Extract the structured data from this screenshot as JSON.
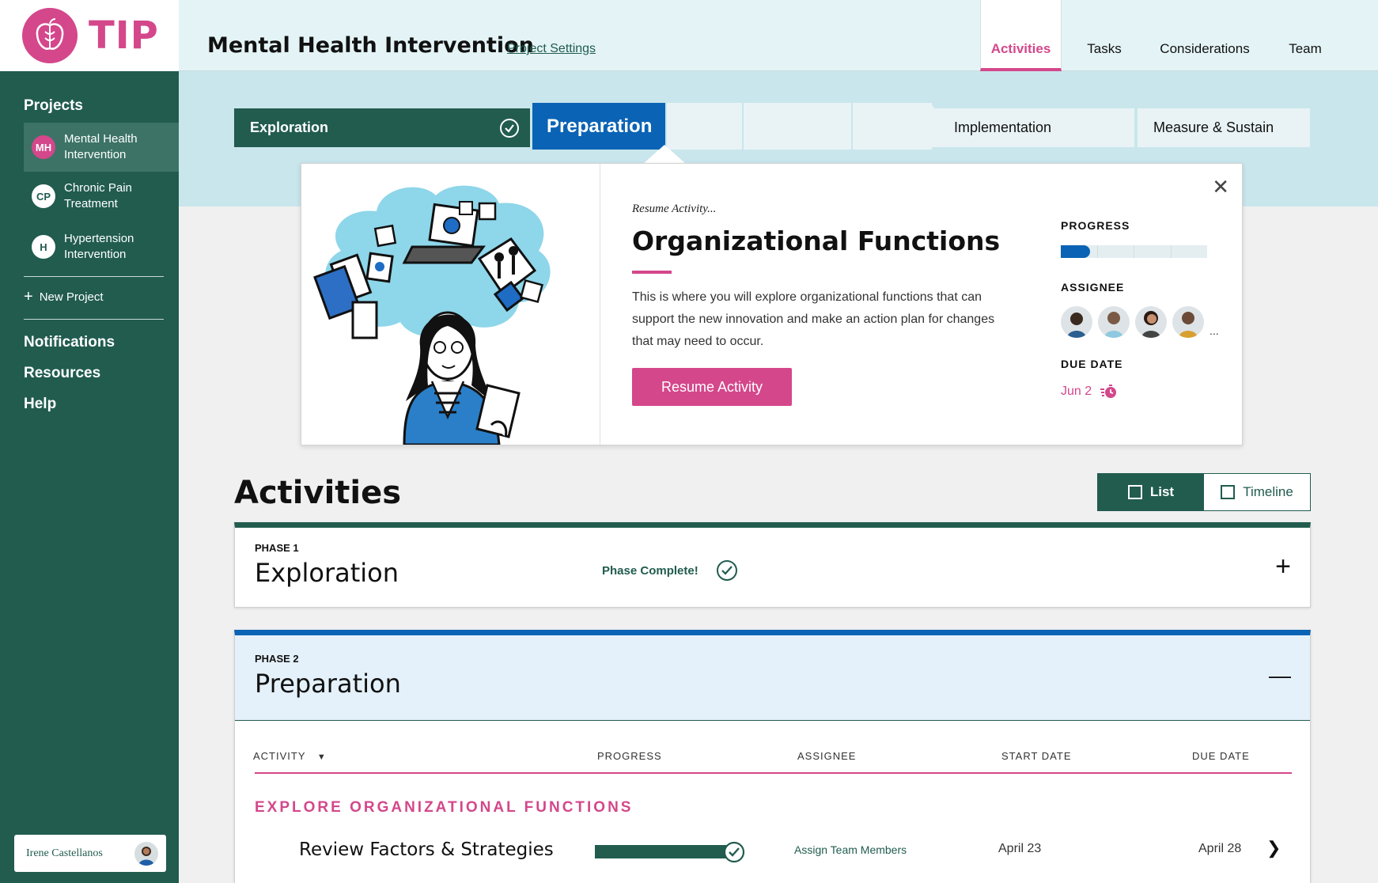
{
  "brand": {
    "logo_text": "TIP",
    "accent": "#d4478b",
    "primary": "#215c4f",
    "blue": "#0a63b5"
  },
  "sidebar": {
    "projects_heading": "Projects",
    "projects": [
      {
        "badge": "MH",
        "label": "Mental Health Intervention",
        "active": true
      },
      {
        "badge": "CP",
        "label": "Chronic Pain Treatment",
        "active": false
      },
      {
        "badge": "H",
        "label": "Hypertension Intervention",
        "active": false
      }
    ],
    "new_project": "New Project",
    "links": [
      "Notifications",
      "Resources",
      "Help"
    ],
    "user_name": "Irene Castellanos"
  },
  "header": {
    "title": "Mental Health Intervention",
    "settings_link": "Project Settings",
    "tabs": [
      "Activities",
      "Tasks",
      "Considerations",
      "Team"
    ],
    "active_tab": "Activities"
  },
  "stepper": {
    "steps": [
      "Exploration",
      "Preparation",
      "Implementation",
      "Measure & Sustain"
    ],
    "completed": "Exploration",
    "current": "Preparation"
  },
  "popup": {
    "eyebrow": "Resume Activity...",
    "title": "Organizational Functions",
    "description": "This is where you will explore organizational functions that can support the new innovation and make an action plan for changes that may need to occur.",
    "button": "Resume Activity",
    "progress_label": "PROGRESS",
    "progress_fraction": 0.2,
    "assignee_label": "ASSIGNEE",
    "assignee_more": "...",
    "due_label": "DUE DATE",
    "due_value": "Jun 2",
    "close_icon": "close-icon"
  },
  "activities": {
    "heading": "Activities",
    "view_list": "List",
    "view_timeline": "Timeline",
    "phase1": {
      "number": "PHASE 1",
      "name": "Exploration",
      "status": "Phase Complete!",
      "toggle": "+"
    },
    "phase2": {
      "number": "PHASE 2",
      "name": "Preparation",
      "toggle": "—",
      "columns": [
        "ACTIVITY",
        "PROGRESS",
        "ASSIGNEE",
        "START DATE",
        "DUE DATE"
      ],
      "group": "EXPLORE ORGANIZATIONAL FUNCTIONS",
      "rows": [
        {
          "name": "Review Factors & Strategies",
          "progress": 1.0,
          "assignee": "Assign Team Members",
          "start": "April 23",
          "due": "April 28"
        }
      ]
    }
  }
}
